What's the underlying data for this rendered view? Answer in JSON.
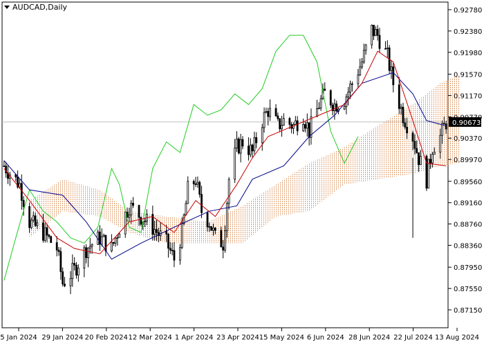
{
  "window": {
    "title": "AUDCAD,Daily",
    "menu_icon": "triangle-down-icon"
  },
  "colors": {
    "background": "#ffffff",
    "border": "#000000",
    "candle": "#000000",
    "tenkan": "#cc0000",
    "kijun": "#00008b",
    "chikou": "#22cc22",
    "cloud": "#e0a070",
    "cloud_alt": "#c8c8c8",
    "price_line": "#c0c0c0",
    "price_box": "#000000"
  },
  "chart_data": {
    "type": "candlestick",
    "symbol": "AUDCAD",
    "timeframe": "Daily",
    "title": "AUDCAD,Daily",
    "xlabel": "",
    "ylabel": "",
    "ylim": [
      0.8715,
      0.9278
    ],
    "grid": false,
    "y_ticks": [
      "0.92780",
      "0.92380",
      "0.91980",
      "0.91570",
      "0.91170",
      "0.90770",
      "0.90370",
      "0.89970",
      "0.89560",
      "0.89160",
      "0.88760",
      "0.88360",
      "0.87950",
      "0.87550",
      "0.87150"
    ],
    "x_ticks": [
      "5 Jan 2024",
      "29 Jan 2024",
      "20 Feb 2024",
      "12 Mar 2024",
      "1 Apr 2024",
      "23 Apr 2024",
      "15 May 2024",
      "6 Jun 2024",
      "28 Jun 2024",
      "22 Jul 2024",
      "13 Aug 2024"
    ],
    "current_price": "0.90673",
    "close_path": [
      [
        "2024-01-02",
        0.8985
      ],
      [
        "2024-01-10",
        0.895
      ],
      [
        "2024-01-15",
        0.888
      ],
      [
        "2024-01-22",
        0.886
      ],
      [
        "2024-01-29",
        0.883
      ],
      [
        "2024-02-01",
        0.8765
      ],
      [
        "2024-02-07",
        0.879
      ],
      [
        "2024-02-13",
        0.883
      ],
      [
        "2024-02-20",
        0.885
      ],
      [
        "2024-02-26",
        0.883
      ],
      [
        "2024-03-01",
        0.887
      ],
      [
        "2024-03-06",
        0.891
      ],
      [
        "2024-03-12",
        0.889
      ],
      [
        "2024-03-18",
        0.887
      ],
      [
        "2024-03-25",
        0.884
      ],
      [
        "2024-03-29",
        0.881
      ],
      [
        "2024-04-02",
        0.886
      ],
      [
        "2024-04-05",
        0.894
      ],
      [
        "2024-04-09",
        0.896
      ],
      [
        "2024-04-12",
        0.89
      ],
      [
        "2024-04-16",
        0.888
      ],
      [
        "2024-04-19",
        0.885
      ],
      [
        "2024-04-23",
        0.884
      ],
      [
        "2024-04-26",
        0.896
      ],
      [
        "2024-04-30",
        0.902
      ],
      [
        "2024-05-03",
        0.903
      ],
      [
        "2024-05-08",
        0.901
      ],
      [
        "2024-05-13",
        0.907
      ],
      [
        "2024-05-16",
        0.909
      ],
      [
        "2024-05-21",
        0.906
      ],
      [
        "2024-05-24",
        0.907
      ],
      [
        "2024-05-29",
        0.906
      ],
      [
        "2024-06-03",
        0.908
      ],
      [
        "2024-06-06",
        0.905
      ],
      [
        "2024-06-11",
        0.91
      ],
      [
        "2024-06-14",
        0.912
      ],
      [
        "2024-06-19",
        0.91
      ],
      [
        "2024-06-24",
        0.911
      ],
      [
        "2024-06-28",
        0.914
      ],
      [
        "2024-07-03",
        0.918
      ],
      [
        "2024-07-08",
        0.924
      ],
      [
        "2024-07-11",
        0.923
      ],
      [
        "2024-07-16",
        0.919
      ],
      [
        "2024-07-19",
        0.914
      ],
      [
        "2024-07-24",
        0.908
      ],
      [
        "2024-07-29",
        0.904
      ],
      [
        "2024-08-01",
        0.9
      ],
      [
        "2024-08-05",
        0.896
      ],
      [
        "2024-08-08",
        0.902
      ],
      [
        "2024-08-12",
        0.904
      ],
      [
        "2024-08-15",
        0.9067
      ]
    ],
    "spike_low": {
      "date": "2024-07-29",
      "high": 0.9,
      "low": 0.885
    },
    "tenkan_path": [
      [
        "2024-01-02",
        0.898
      ],
      [
        "2024-01-15",
        0.892
      ],
      [
        "2024-01-29",
        0.885
      ],
      [
        "2024-02-07",
        0.883
      ],
      [
        "2024-02-20",
        0.882
      ],
      [
        "2024-03-06",
        0.888
      ],
      [
        "2024-03-18",
        0.889
      ],
      [
        "2024-03-29",
        0.886
      ],
      [
        "2024-04-09",
        0.892
      ],
      [
        "2024-04-19",
        0.889
      ],
      [
        "2024-04-30",
        0.895
      ],
      [
        "2024-05-08",
        0.9
      ],
      [
        "2024-05-16",
        0.904
      ],
      [
        "2024-05-29",
        0.906
      ],
      [
        "2024-06-11",
        0.908
      ],
      [
        "2024-06-24",
        0.91
      ],
      [
        "2024-07-03",
        0.914
      ],
      [
        "2024-07-11",
        0.92
      ],
      [
        "2024-07-19",
        0.918
      ],
      [
        "2024-07-29",
        0.907
      ],
      [
        "2024-08-05",
        0.899
      ],
      [
        "2024-08-15",
        0.8985
      ]
    ],
    "kijun_path": [
      [
        "2024-01-02",
        0.8995
      ],
      [
        "2024-01-15",
        0.894
      ],
      [
        "2024-02-01",
        0.893
      ],
      [
        "2024-02-13",
        0.888
      ],
      [
        "2024-02-26",
        0.881
      ],
      [
        "2024-03-12",
        0.884
      ],
      [
        "2024-03-29",
        0.887
      ],
      [
        "2024-04-16",
        0.89
      ],
      [
        "2024-04-30",
        0.891
      ],
      [
        "2024-05-08",
        0.896
      ],
      [
        "2024-05-24",
        0.8985
      ],
      [
        "2024-06-06",
        0.904
      ],
      [
        "2024-06-19",
        0.908
      ],
      [
        "2024-07-03",
        0.914
      ],
      [
        "2024-07-19",
        0.916
      ],
      [
        "2024-07-29",
        0.912
      ],
      [
        "2024-08-05",
        0.907
      ],
      [
        "2024-08-15",
        0.906
      ]
    ],
    "chikou_path": [
      [
        "2024-01-02",
        0.877
      ],
      [
        "2024-01-08",
        0.885
      ],
      [
        "2024-01-15",
        0.894
      ],
      [
        "2024-01-22",
        0.89
      ],
      [
        "2024-01-29",
        0.888
      ],
      [
        "2024-02-05",
        0.885
      ],
      [
        "2024-02-12",
        0.884
      ],
      [
        "2024-02-19",
        0.887
      ],
      [
        "2024-02-26",
        0.898
      ],
      [
        "2024-03-01",
        0.895
      ],
      [
        "2024-03-06",
        0.887
      ],
      [
        "2024-03-12",
        0.886
      ],
      [
        "2024-03-18",
        0.898
      ],
      [
        "2024-03-25",
        0.903
      ],
      [
        "2024-04-01",
        0.901
      ],
      [
        "2024-04-08",
        0.91
      ],
      [
        "2024-04-15",
        0.908
      ],
      [
        "2024-04-22",
        0.909
      ],
      [
        "2024-04-29",
        0.912
      ],
      [
        "2024-05-06",
        0.91
      ],
      [
        "2024-05-13",
        0.913
      ],
      [
        "2024-05-20",
        0.92
      ],
      [
        "2024-05-27",
        0.923
      ],
      [
        "2024-06-03",
        0.923
      ],
      [
        "2024-06-10",
        0.918
      ],
      [
        "2024-06-17",
        0.905
      ],
      [
        "2024-06-24",
        0.899
      ],
      [
        "2024-07-01",
        0.904
      ]
    ],
    "cloud_path": [
      [
        "2024-01-15",
        0.892,
        0.885
      ],
      [
        "2024-02-01",
        0.896,
        0.89
      ],
      [
        "2024-02-20",
        0.894,
        0.889
      ],
      [
        "2024-03-06",
        0.89,
        0.886
      ],
      [
        "2024-03-25",
        0.889,
        0.884
      ],
      [
        "2024-04-15",
        0.888,
        0.884
      ],
      [
        "2024-05-03",
        0.891,
        0.884
      ],
      [
        "2024-05-20",
        0.895,
        0.889
      ],
      [
        "2024-06-06",
        0.899,
        0.89
      ],
      [
        "2024-06-24",
        0.902,
        0.895
      ],
      [
        "2024-07-11",
        0.906,
        0.896
      ],
      [
        "2024-07-29",
        0.91,
        0.897
      ],
      [
        "2024-08-12",
        0.914,
        0.8985
      ],
      [
        "2024-08-22",
        0.9155,
        0.899
      ]
    ]
  }
}
